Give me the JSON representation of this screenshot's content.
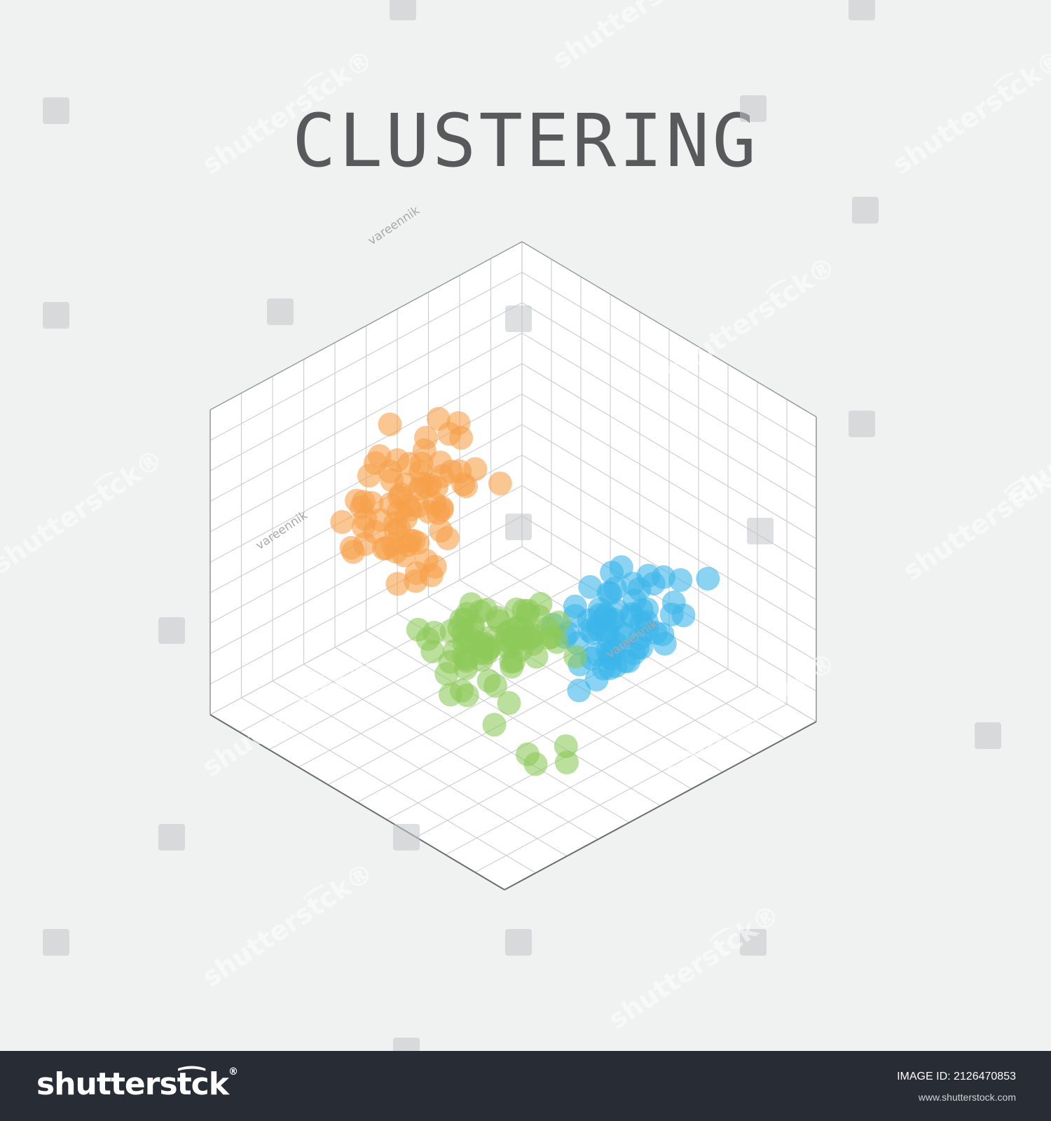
{
  "chart_data": {
    "type": "scatter",
    "title": "CLUSTERING",
    "projection": "isometric-3d",
    "grid": true,
    "colors": {
      "orange": "#f7a04a",
      "blue": "#3cb5ea",
      "green": "#8ec95a"
    },
    "series": [
      {
        "color": "#f7a04a",
        "points": [
          [
            4.0,
            7.2,
            1.4
          ],
          [
            4.3,
            7.8,
            2.4
          ],
          [
            4.8,
            7.0,
            0.6
          ],
          [
            4.6,
            6.5,
            2.1
          ],
          [
            4.9,
            5.8,
            1.8
          ],
          [
            5.3,
            6.9,
            2.9
          ],
          [
            5.6,
            6.6,
            2.7
          ],
          [
            5.4,
            5.9,
            1.3
          ],
          [
            5.9,
            5.5,
            2.3
          ],
          [
            5.8,
            6.2,
            3.3
          ],
          [
            6.2,
            6.9,
            3.6
          ],
          [
            6.4,
            5.8,
            1.4
          ],
          [
            6.8,
            6.0,
            2.4
          ],
          [
            6.9,
            5.3,
            2.7
          ],
          [
            6.5,
            5.1,
            1.5
          ],
          [
            6.8,
            5.9,
            3.4
          ],
          [
            7.0,
            6.4,
            1.8
          ],
          [
            6.1,
            4.9,
            2.6
          ],
          [
            6.7,
            4.4,
            1.3
          ],
          [
            7.3,
            5.0,
            2.0
          ],
          [
            7.4,
            5.6,
            2.5
          ],
          [
            6.6,
            6.4,
            2.8
          ],
          [
            5.7,
            6.8,
            1.2
          ],
          [
            6.3,
            7.2,
            2.2
          ],
          [
            7.2,
            6.2,
            2.3
          ],
          [
            5.8,
            7.2,
            2.7
          ],
          [
            6.3,
            4.6,
            3.6
          ],
          [
            5.9,
            5.0,
            0.8
          ],
          [
            7.2,
            4.7,
            3.4
          ],
          [
            6.0,
            5.9,
            3.6
          ],
          [
            5.3,
            7.4,
            3.5
          ],
          [
            6.9,
            5.3,
            1.2
          ],
          [
            5.5,
            6.1,
            3.1
          ],
          [
            6.1,
            6.4,
            3.3
          ],
          [
            5.2,
            6.8,
            2.1
          ],
          [
            6.1,
            6.2,
            2.6
          ],
          [
            6.6,
            7.0,
            1.8
          ],
          [
            6.8,
            5.3,
            3.2
          ],
          [
            4.5,
            7.6,
            2.7
          ],
          [
            5.7,
            5.9,
            2.5
          ],
          [
            5.8,
            4.4,
            2.9
          ],
          [
            5.0,
            6.7,
            3.3
          ],
          [
            6.7,
            6.8,
            3.3
          ],
          [
            6.0,
            5.8,
            1.9
          ],
          [
            5.7,
            4.7,
            2.5
          ],
          [
            5.3,
            5.5,
            1.5
          ],
          [
            6.1,
            6.3,
            2.3
          ],
          [
            6.4,
            7.3,
            1.8
          ],
          [
            6.9,
            4.8,
            3.7
          ],
          [
            5.1,
            6.2,
            2.5
          ],
          [
            6.0,
            4.6,
            3.4
          ],
          [
            6.3,
            5.5,
            2.5
          ],
          [
            5.4,
            6.5,
            2.6
          ],
          [
            6.6,
            4.9,
            2.3
          ],
          [
            5.5,
            6.9,
            2.0
          ],
          [
            6.4,
            4.8,
            2.5
          ],
          [
            6.4,
            5.5,
            3.1
          ],
          [
            6.8,
            5.5,
            2.2
          ],
          [
            5.1,
            6.8,
            3.5
          ],
          [
            5.3,
            7.4,
            2.3
          ],
          [
            6.6,
            5.2,
            2.6
          ],
          [
            5.8,
            6.5,
            2.2
          ],
          [
            5.1,
            7.0,
            3.0
          ],
          [
            6.2,
            7.1,
            3.1
          ],
          [
            6.9,
            6.5,
            2.2
          ],
          [
            5.5,
            5.2,
            3.3
          ],
          [
            4.1,
            6.4,
            3.6
          ],
          [
            5.6,
            6.9,
            1.7
          ],
          [
            4.4,
            6.8,
            1.4
          ],
          [
            6.5,
            5.6,
            2.6
          ],
          [
            6.9,
            6.3,
            3.0
          ],
          [
            4.8,
            7.2,
            3.5
          ],
          [
            4.5,
            7.5,
            2.3
          ],
          [
            6.4,
            4.5,
            3.2
          ],
          [
            5.3,
            5.8,
            2.9
          ]
        ]
      },
      {
        "color": "#3cb5ea",
        "points": [
          [
            2.3,
            3.8,
            7.6
          ],
          [
            1.9,
            4.2,
            7.4
          ],
          [
            2.6,
            3.4,
            7.0
          ],
          [
            1.8,
            3.6,
            6.2
          ],
          [
            2.4,
            2.6,
            6.6
          ],
          [
            2.2,
            3.0,
            5.5
          ],
          [
            2.8,
            3.0,
            6.2
          ],
          [
            3.0,
            2.8,
            6.0
          ],
          [
            3.1,
            3.6,
            5.6
          ],
          [
            3.5,
            2.6,
            6.1
          ],
          [
            3.2,
            2.1,
            6.5
          ],
          [
            3.6,
            3.1,
            6.4
          ],
          [
            3.9,
            2.4,
            5.6
          ],
          [
            3.6,
            1.9,
            6.8
          ],
          [
            4.1,
            2.8,
            5.4
          ],
          [
            3.3,
            2.4,
            5.8
          ],
          [
            3.0,
            1.8,
            6.8
          ],
          [
            2.6,
            2.1,
            6.1
          ],
          [
            2.7,
            3.3,
            5.8
          ],
          [
            3.2,
            2.6,
            6.3
          ],
          [
            3.0,
            2.6,
            6.7
          ],
          [
            3.3,
            2.6,
            6.1
          ],
          [
            2.5,
            2.6,
            6.9
          ],
          [
            2.8,
            3.1,
            6.7
          ],
          [
            3.3,
            2.9,
            5.3
          ],
          [
            4.0,
            1.9,
            6.2
          ],
          [
            3.7,
            2.2,
            5.8
          ],
          [
            1.9,
            2.9,
            7.1
          ],
          [
            2.2,
            3.9,
            6.8
          ],
          [
            3.1,
            2.9,
            7.3
          ],
          [
            1.5,
            3.5,
            6.4
          ],
          [
            3.2,
            3.1,
            6.5
          ],
          [
            2.9,
            2.3,
            7.0
          ],
          [
            2.1,
            3.7,
            5.6
          ],
          [
            4.4,
            1.5,
            6.6
          ],
          [
            3.4,
            2.6,
            6.8
          ],
          [
            3.2,
            3.9,
            6.4
          ],
          [
            1.9,
            3.1,
            6.0
          ],
          [
            2.4,
            1.8,
            6.6
          ],
          [
            2.1,
            2.3,
            7.0
          ],
          [
            4.2,
            2.8,
            7.0
          ],
          [
            2.6,
            2.3,
            5.4
          ],
          [
            2.2,
            3.5,
            6.1
          ],
          [
            3.5,
            2.3,
            7.2
          ],
          [
            3.8,
            2.1,
            6.4
          ],
          [
            2.7,
            2.6,
            5.5
          ],
          [
            4.0,
            2.7,
            5.8
          ],
          [
            1.4,
            4.2,
            7.8
          ],
          [
            4.4,
            2.2,
            7.2
          ],
          [
            1.9,
            3.1,
            7.5
          ],
          [
            3.2,
            2.4,
            7.2
          ],
          [
            2.9,
            3.8,
            6.9
          ],
          [
            3.0,
            3.4,
            6.9
          ],
          [
            3.4,
            2.7,
            5.4
          ],
          [
            3.8,
            3.3,
            6.3
          ],
          [
            3.3,
            2.1,
            6.4
          ],
          [
            3.2,
            3.0,
            6.4
          ],
          [
            2.5,
            3.8,
            5.7
          ],
          [
            2.2,
            2.8,
            6.4
          ],
          [
            3.4,
            2.0,
            6.6
          ],
          [
            2.7,
            3.1,
            7.1
          ],
          [
            3.5,
            2.8,
            6.6
          ],
          [
            2.6,
            2.4,
            5.6
          ],
          [
            3.4,
            2.2,
            6.6
          ],
          [
            3.8,
            2.0,
            6.8
          ],
          [
            2.5,
            2.5,
            7.5
          ],
          [
            3.7,
            2.2,
            7.1
          ],
          [
            2.6,
            2.8,
            7.3
          ]
        ]
      },
      {
        "color": "#8ec95a",
        "points": [
          [
            6.9,
            1.3,
            7.5
          ],
          [
            7.3,
            1.6,
            8.2
          ],
          [
            6.3,
            1.1,
            8.2
          ],
          [
            7.4,
            2.2,
            6.9
          ],
          [
            6.8,
            2.2,
            8.7
          ],
          [
            7.4,
            3.2,
            7.4
          ],
          [
            7.8,
            3.1,
            6.4
          ],
          [
            7.4,
            3.4,
            5.4
          ],
          [
            7.4,
            3.4,
            4.8
          ],
          [
            6.5,
            3.9,
            5.2
          ],
          [
            5.7,
            3.1,
            4.1
          ],
          [
            6.2,
            3.6,
            4.5
          ],
          [
            5.7,
            3.8,
            5.2
          ],
          [
            6.5,
            2.8,
            4.6
          ],
          [
            6.3,
            2.8,
            5.3
          ],
          [
            5.6,
            3.5,
            5.9
          ],
          [
            5.8,
            4.0,
            6.0
          ],
          [
            6.2,
            2.9,
            5.2
          ],
          [
            5.4,
            4.1,
            6.6
          ],
          [
            6.1,
            2.8,
            4.5
          ],
          [
            6.5,
            3.0,
            3.9
          ],
          [
            7.2,
            3.6,
            4.1
          ],
          [
            7.2,
            2.1,
            5.2
          ],
          [
            5.9,
            2.7,
            5.9
          ],
          [
            6.7,
            2.9,
            3.9
          ],
          [
            6.6,
            3.5,
            4.6
          ],
          [
            5.6,
            2.6,
            3.8
          ],
          [
            5.1,
            3.8,
            5.6
          ],
          [
            4.2,
            3.1,
            5.7
          ],
          [
            5.3,
            3.2,
            4.2
          ],
          [
            5.5,
            3.5,
            4.1
          ],
          [
            5.8,
            3.7,
            5.7
          ],
          [
            6.8,
            2.8,
            6.3
          ],
          [
            5.7,
            3.2,
            6.0
          ],
          [
            5.3,
            3.3,
            5.9
          ],
          [
            5.8,
            2.7,
            4.8
          ],
          [
            6.2,
            3.6,
            5.5
          ],
          [
            6.8,
            2.8,
            5.3
          ],
          [
            6.3,
            3.3,
            4.9
          ],
          [
            6.5,
            2.7,
            5.0
          ],
          [
            5.5,
            3.2,
            5.5
          ],
          [
            4.8,
            3.1,
            6.0
          ],
          [
            5.5,
            3.4,
            6.2
          ],
          [
            6.2,
            3.2,
            6.2
          ],
          [
            6.4,
            3.5,
            6.5
          ],
          [
            5.0,
            2.9,
            4.5
          ],
          [
            7.2,
            3.3,
            6.5
          ],
          [
            6.7,
            3.6,
            5.9
          ],
          [
            6.7,
            3.0,
            5.2
          ],
          [
            7.5,
            2.8,
            5.9
          ],
          [
            4.9,
            3.0,
            5.6
          ],
          [
            5.2,
            3.0,
            5.5
          ],
          [
            5.3,
            3.7,
            6.8
          ],
          [
            6.1,
            3.5,
            6.0
          ],
          [
            5.9,
            3.3,
            4.6
          ],
          [
            6.5,
            3.6,
            5.8
          ],
          [
            6.1,
            2.9,
            4.6
          ],
          [
            4.8,
            3.0,
            6.9
          ],
          [
            5.0,
            3.1,
            5.2
          ],
          [
            5.4,
            2.9,
            5.2
          ],
          [
            6.2,
            3.2,
            5.1
          ],
          [
            7.8,
            3.4,
            5.7
          ],
          [
            5.8,
            3.9,
            6.4
          ],
          [
            5.4,
            4.3,
            6.3
          ],
          [
            4.5,
            3.7,
            5.4
          ],
          [
            6.1,
            3.8,
            4.6
          ],
          [
            6.8,
            3.9,
            5.2
          ],
          [
            5.2,
            2.6,
            5.2
          ],
          [
            5.3,
            3.0,
            5.1
          ],
          [
            4.9,
            3.3,
            6.2
          ],
          [
            4.8,
            3.4,
            4.9
          ],
          [
            5.8,
            2.7,
            5.0
          ],
          [
            5.7,
            3.9,
            6.1
          ],
          [
            5.5,
            3.6,
            4.6
          ],
          [
            4.9,
            3.7,
            5.4
          ],
          [
            5.2,
            2.7,
            6.0
          ],
          [
            4.2,
            2.8,
            4.5
          ],
          [
            6.5,
            3.6,
            5.6
          ],
          [
            5.7,
            3.4,
            5.7
          ],
          [
            6.6,
            2.9,
            5.0
          ]
        ]
      }
    ]
  },
  "watermark": {
    "brand": "shutterst͡ck",
    "brand_suffix": "®",
    "contributor": "vareennik"
  },
  "footer": {
    "logo": "shutterst͡ck",
    "logo_suffix": "®",
    "image_id": "IMAGE ID: 2126470853",
    "url": "www.shutterstock.com"
  }
}
